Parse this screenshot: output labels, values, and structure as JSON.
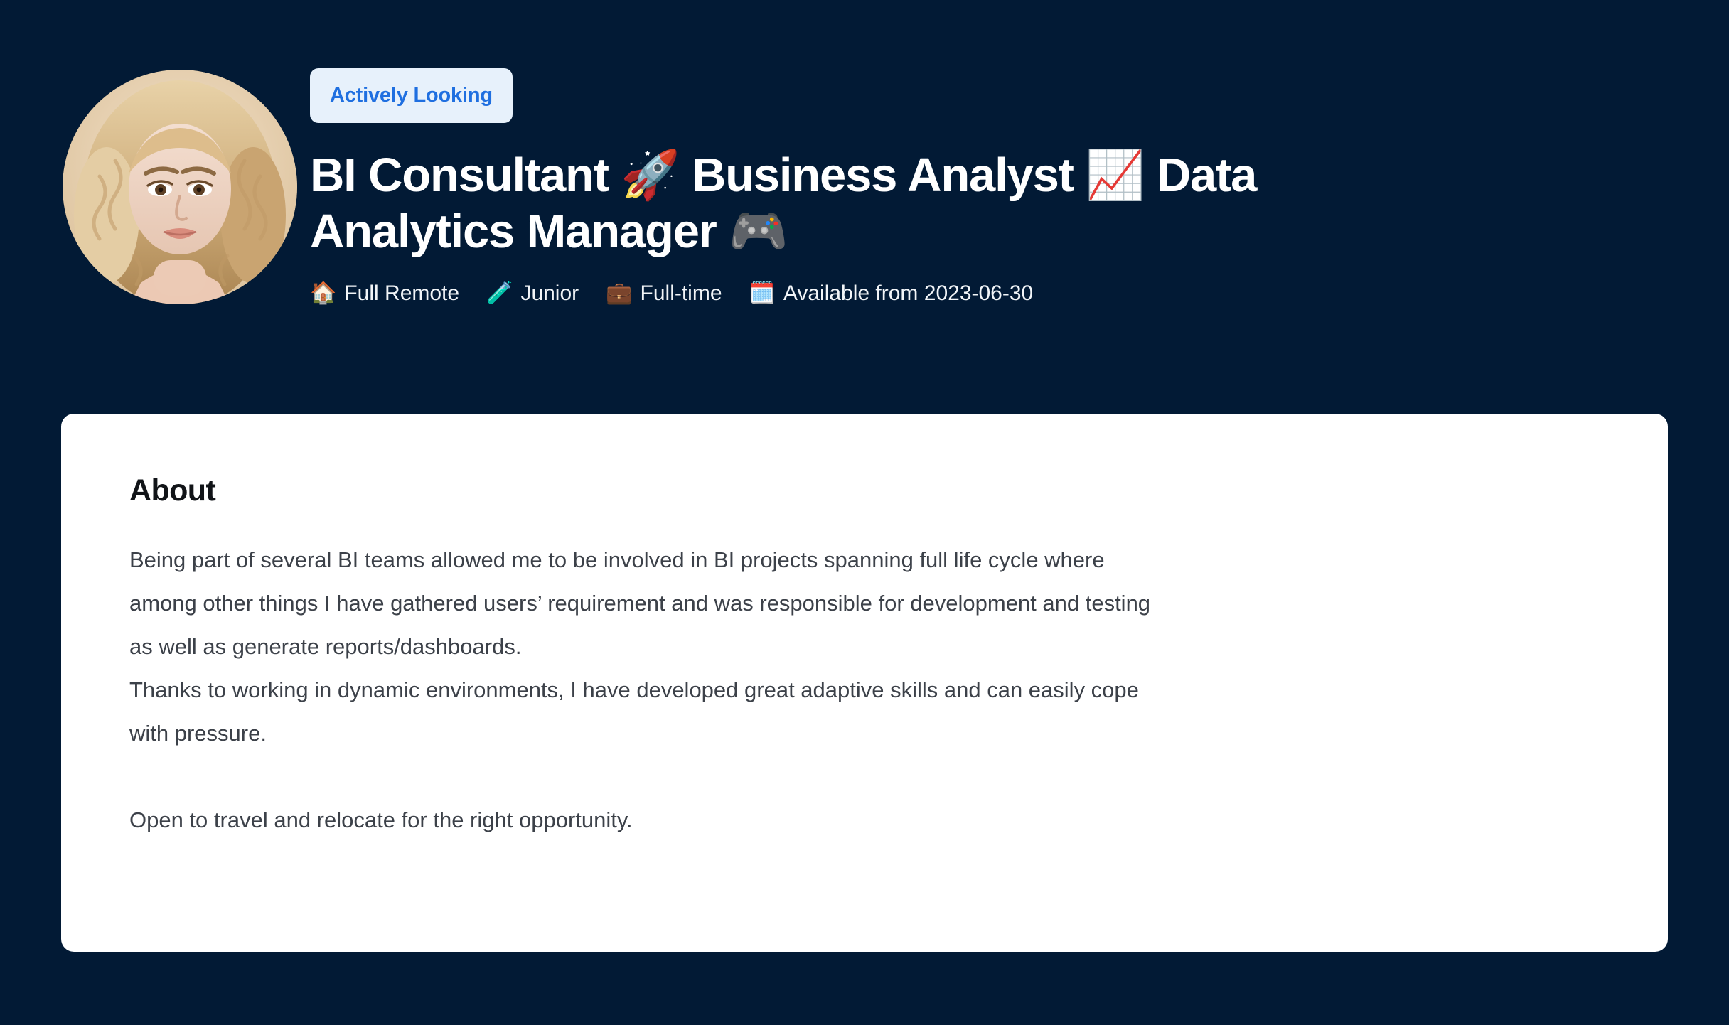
{
  "theme": {
    "page_background": "#021a35",
    "card_background": "#ffffff",
    "badge_background": "#e7f1fb",
    "badge_text_color": "#1f6fe0",
    "title_color": "#ffffff",
    "body_text_color": "#3c4149"
  },
  "profile": {
    "avatar_alt": "profile-photo",
    "status_badge": "Actively Looking",
    "title": "BI Consultant 🚀 Business Analyst 📈 Data Analytics Manager 🎮",
    "meta": [
      {
        "icon": "🏠",
        "icon_name": "house-icon",
        "label": "Full Remote"
      },
      {
        "icon": "🧪",
        "icon_name": "test-tube-icon",
        "label": "Junior"
      },
      {
        "icon": "💼",
        "icon_name": "briefcase-icon",
        "label": "Full-time"
      },
      {
        "icon": "🗓️",
        "icon_name": "calendar-icon",
        "label": "Available from 2023-06-30"
      }
    ]
  },
  "about": {
    "heading": "About",
    "body": "Being part of several BI teams allowed me to be involved in BI projects spanning full life cycle where among other things I have gathered users’ requirement and was responsible for development and testing as well as generate reports/dashboards.\nThanks to working in dynamic environments, I have developed great adaptive skills and can easily cope with pressure.\n\nOpen to travel and relocate for the right opportunity."
  }
}
